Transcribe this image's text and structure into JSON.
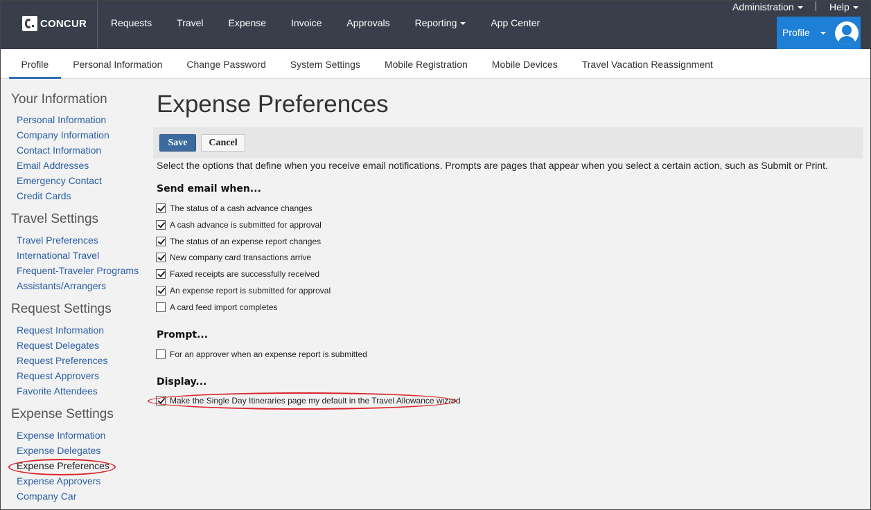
{
  "app": {
    "logo_text": "CONCUR"
  },
  "main_nav": [
    {
      "label": "Requests"
    },
    {
      "label": "Travel"
    },
    {
      "label": "Expense"
    },
    {
      "label": "Invoice"
    },
    {
      "label": "Approvals"
    },
    {
      "label": "Reporting",
      "has_menu": true
    },
    {
      "label": "App Center"
    }
  ],
  "utility": {
    "administration_label": "Administration",
    "help_label": "Help"
  },
  "profile_menu": {
    "label": "Profile",
    "icon": "user-icon"
  },
  "sub_nav": [
    {
      "label": "Profile",
      "active": true
    },
    {
      "label": "Personal Information"
    },
    {
      "label": "Change Password"
    },
    {
      "label": "System Settings"
    },
    {
      "label": "Mobile Registration"
    },
    {
      "label": "Mobile Devices"
    },
    {
      "label": "Travel Vacation Reassignment"
    }
  ],
  "sidebar": {
    "sections": [
      {
        "heading": "Your Information",
        "links": [
          "Personal Information",
          "Company Information",
          "Contact Information",
          "Email Addresses",
          "Emergency Contact",
          "Credit Cards"
        ]
      },
      {
        "heading": "Travel Settings",
        "links": [
          "Travel Preferences",
          "International Travel",
          "Frequent-Traveler Programs",
          "Assistants/Arrangers"
        ]
      },
      {
        "heading": "Request Settings",
        "links": [
          "Request Information",
          "Request Delegates",
          "Request Preferences",
          "Request Approvers",
          "Favorite Attendees"
        ]
      },
      {
        "heading": "Expense Settings",
        "links": [
          "Expense Information",
          "Expense Delegates",
          "Expense Preferences",
          "Expense Approvers",
          "Company Car"
        ]
      }
    ],
    "current_link": "Expense Preferences"
  },
  "page": {
    "title": "Expense Preferences",
    "save_label": "Save",
    "cancel_label": "Cancel",
    "intro": "Select the options that define when you receive email notifications. Prompts are pages that appear when you select a certain action, such as Submit or Print."
  },
  "sections": {
    "send_email": {
      "heading": "Send email when...",
      "options": [
        {
          "label": "The status of a cash advance changes",
          "checked": true
        },
        {
          "label": "A cash advance is submitted for approval",
          "checked": true
        },
        {
          "label": "The status of an expense report changes",
          "checked": true
        },
        {
          "label": "New company card transactions arrive",
          "checked": true
        },
        {
          "label": "Faxed receipts are successfully received",
          "checked": true
        },
        {
          "label": "An expense report is submitted for approval",
          "checked": true
        },
        {
          "label": "A card feed import completes",
          "checked": false
        }
      ]
    },
    "prompt": {
      "heading": "Prompt...",
      "options": [
        {
          "label": "For an approver when an expense report is submitted",
          "checked": false
        }
      ]
    },
    "display": {
      "heading": "Display...",
      "options": [
        {
          "label": "Make the Single Day Itineraries page my default in the Travel Allowance wizard",
          "checked": true
        }
      ]
    }
  },
  "colors": {
    "top_bar": "#383e4a",
    "profile_button": "#1e7fd6",
    "link": "#2a5ea6",
    "save_button": "#3a6aa0",
    "highlight": "#d9262b"
  }
}
